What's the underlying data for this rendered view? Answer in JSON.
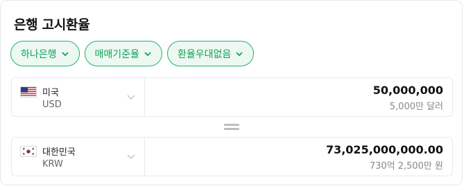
{
  "header": {
    "title": "은행 고시환율"
  },
  "filters": [
    {
      "label": "하나은행"
    },
    {
      "label": "매매기준율"
    },
    {
      "label": "환율우대없음"
    }
  ],
  "from": {
    "country": "미국",
    "code": "USD",
    "flag_icon": "us-flag-icon",
    "amount": "50,000,000",
    "amount_text": "5,000만 달러"
  },
  "to": {
    "country": "대한민국",
    "code": "KRW",
    "flag_icon": "kr-flag-icon",
    "amount": "73,025,000,000.00",
    "amount_text": "730억 2,500만 원"
  },
  "colors": {
    "accent": "#12a05a",
    "chip_bg": "#ecf8f1",
    "border": "#e6e8ec"
  }
}
